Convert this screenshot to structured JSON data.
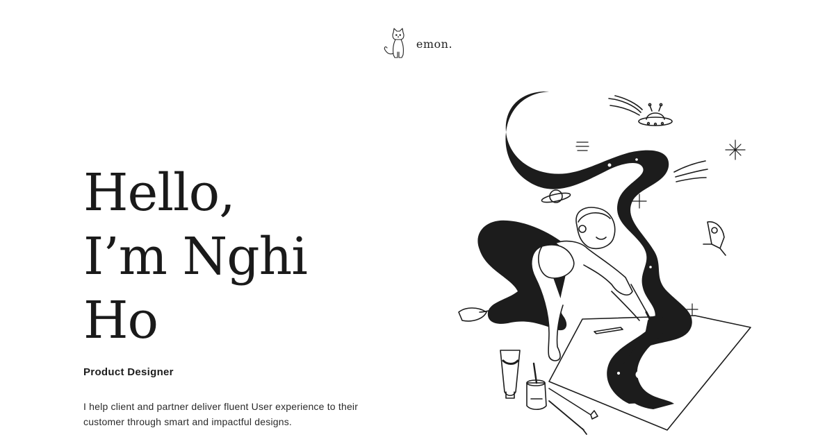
{
  "header": {
    "logo_text": "emon.",
    "logo_icon": "cat-icon"
  },
  "hero": {
    "greeting_line1": "Hello,",
    "greeting_line2": "I’m Nghi Ho",
    "role": "Product Designer",
    "description": "I help client and partner deliver fluent User experience to their customer through smart and impactful designs."
  },
  "illustration": {
    "subject": "girl-painting-galaxy-illustration",
    "colors": {
      "ink": "#1c1c1c",
      "paper": "#ffffff"
    }
  }
}
